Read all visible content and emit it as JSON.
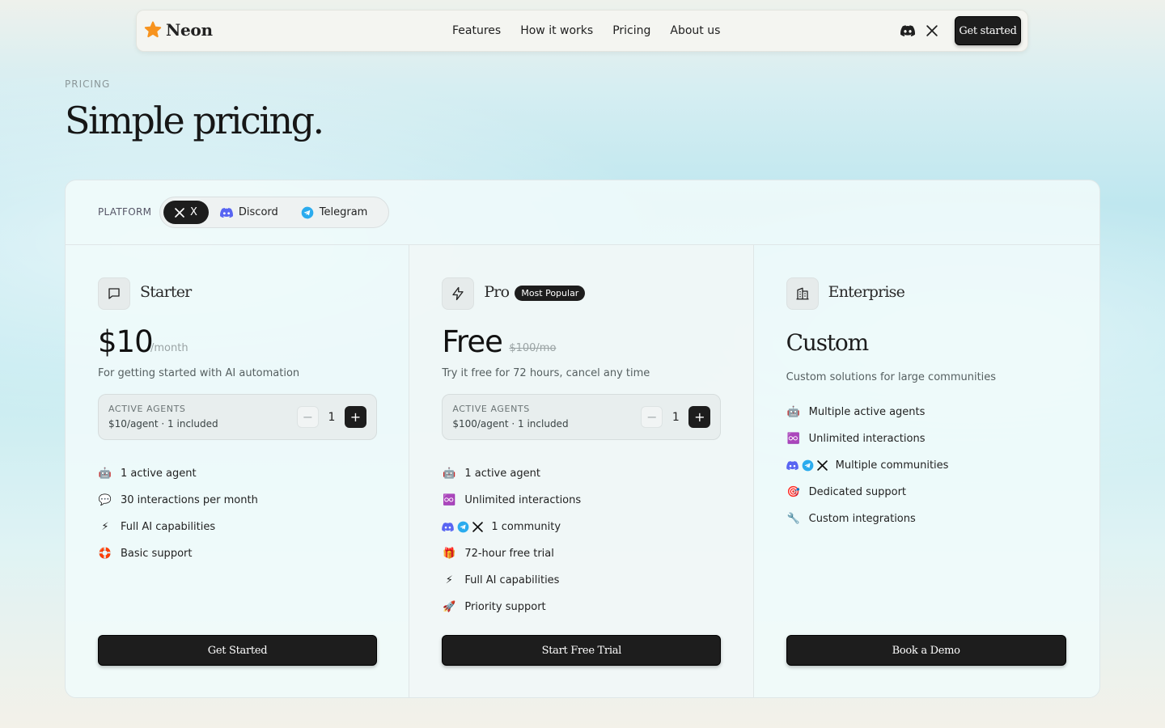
{
  "brand": {
    "name": "Neon"
  },
  "nav": {
    "links": [
      "Features",
      "How it works",
      "Pricing",
      "About us"
    ],
    "cta": "Get started"
  },
  "header": {
    "eyebrow": "PRICING",
    "title": "Simple pricing."
  },
  "platform": {
    "label": "PLATFORM",
    "options": [
      "X",
      "Discord",
      "Telegram"
    ],
    "selected": "X"
  },
  "plans": [
    {
      "name": "Starter",
      "price": "$10",
      "price_sub": "/month",
      "description": "For getting started with AI automation",
      "agents": {
        "label": "ACTIVE AGENTS",
        "sub": "$10/agent · 1 included",
        "value": "1"
      },
      "features": [
        "1 active agent",
        "30 interactions per month",
        "Full AI capabilities",
        "Basic support"
      ],
      "cta": "Get Started"
    },
    {
      "name": "Pro",
      "badge": "Most Popular",
      "price": "Free",
      "price_sub": "$100/mo",
      "description": "Try it free for 72 hours, cancel any time",
      "agents": {
        "label": "ACTIVE AGENTS",
        "sub": "$100/agent · 1 included",
        "value": "1"
      },
      "features": [
        "1 active agent",
        "Unlimited interactions",
        "1 community",
        "72-hour free trial",
        "Full AI capabilities",
        "Priority support"
      ],
      "cta": "Start Free Trial"
    },
    {
      "name": "Enterprise",
      "price": "Custom",
      "description": "Custom solutions for large communities",
      "features": [
        "Multiple active agents",
        "Unlimited interactions",
        "Multiple communities",
        "Dedicated support",
        "Custom integrations"
      ],
      "cta": "Book a Demo"
    }
  ],
  "colors": {
    "accent_dark": "#1d1d1d",
    "discord": "#5865F2",
    "telegram": "#2AABEE",
    "logo": "#F7931E"
  }
}
